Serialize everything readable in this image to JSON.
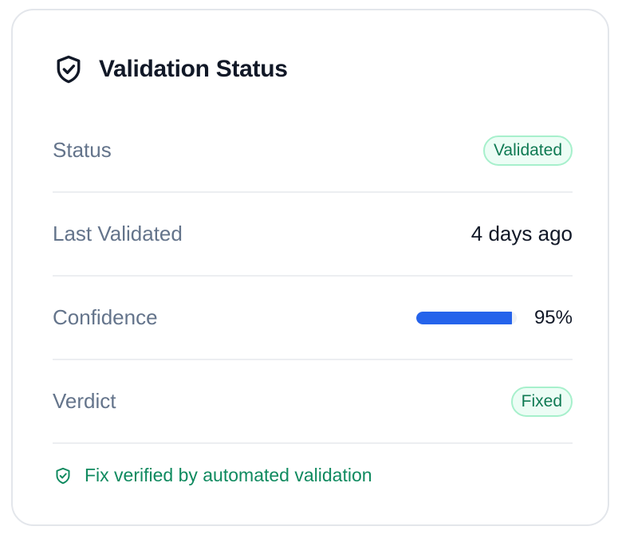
{
  "card": {
    "title": "Validation Status",
    "title_icon": "shield-check-icon"
  },
  "rows": [
    {
      "label": "Status",
      "value": "Validated",
      "type": "badge"
    },
    {
      "label": "Last Validated",
      "value": "4 days ago",
      "type": "text"
    },
    {
      "label": "Confidence",
      "value": "95%",
      "type": "progress",
      "progress_fraction": 0.95
    },
    {
      "label": "Verdict",
      "value": "Fixed",
      "type": "badge"
    }
  ],
  "footer": {
    "icon": "shield-check-icon",
    "text": "Fix verified by automated validation"
  },
  "colors": {
    "accent": "#2563eb",
    "success_text": "#0f7a53",
    "success_bg": "#ecfdf5",
    "success_border": "#a7f0cc",
    "label": "#64748b",
    "title": "#111827"
  }
}
